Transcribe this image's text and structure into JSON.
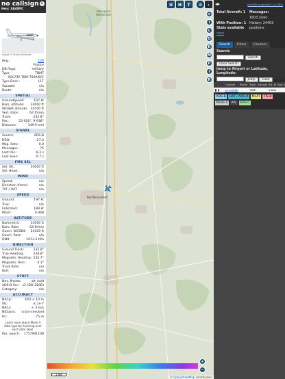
{
  "aircraft": {
    "callsign": "no callsign",
    "hex_label": "Hex: 3A48FC",
    "photo_credit": "Image © Bruno Muthelet",
    "info_rows": [
      {
        "k": "Reg.:",
        "v": "126",
        "link": true
      },
      {
        "k": "",
        "v": "France"
      },
      {
        "k": "DB flags:",
        "v": "military"
      },
      {
        "k": "Type:",
        "v": "TBM7"
      },
      {
        "k": "",
        "v": "SOCATA TBM-700A/B/C"
      },
      {
        "k": "Type Desc.:",
        "v": "L1T"
      },
      {
        "k": "Squawk:",
        "v": "n/a"
      },
      {
        "k": "Route:",
        "v": "n/a"
      }
    ],
    "sections": [
      {
        "title": "SPATIAL",
        "rows": [
          {
            "k": "Groundspeed:",
            "v": "197 kt"
          },
          {
            "k": "Baro. altitude:",
            "v": "24000 ft"
          },
          {
            "k": "WGS84 altitude:",
            "v": "24100 ft"
          },
          {
            "k": "Vert. Rate:",
            "v": "64 ft/min"
          },
          {
            "k": "Track:",
            "v": "232.8°"
          },
          {
            "k": "Pos.:",
            "v": "53.926°, 9.938°"
          },
          {
            "k": "Distance:",
            "v": "149.9 nmi"
          }
        ]
      },
      {
        "title": "SIGNAL",
        "rows": [
          {
            "k": "Source:",
            "v": "ADS-B"
          },
          {
            "k": "RSSI:",
            "v": "-27.5"
          },
          {
            "k": "Msg. Rate:",
            "v": "0.0"
          },
          {
            "k": "Messages:",
            "v": "75"
          },
          {
            "k": "Last Pos.:",
            "v": "8.2 s"
          },
          {
            "k": "Last Seen:",
            "v": "6.7 s"
          }
        ]
      },
      {
        "title": "FMS SEL",
        "rows": [
          {
            "k": "Sel. Alt.:",
            "v": "20000 ft"
          },
          {
            "k": "Sel. Head.:",
            "v": "n/a"
          }
        ]
      },
      {
        "title": "WIND",
        "rows": [
          {
            "k": "Speed:",
            "v": "n/a"
          },
          {
            "k": "Direction (from):",
            "v": "n/a"
          },
          {
            "k": "TAT / OAT:",
            "v": "n/a"
          }
        ]
      },
      {
        "title": "SPEED",
        "rows": [
          {
            "k": "Ground:",
            "v": "197 kt"
          },
          {
            "k": "True:",
            "v": "n/a"
          },
          {
            "k": "Indicated:",
            "v": "189 kt"
          },
          {
            "k": "Mach:",
            "v": "0.468"
          }
        ]
      },
      {
        "title": "ALTITUDE",
        "rows": [
          {
            "k": "Barometric:",
            "v": "24000 ft"
          },
          {
            "k": "Baro. Rate:",
            "v": "64 ft/min"
          },
          {
            "k": "Geom. WGS84:",
            "v": "24100 ft"
          },
          {
            "k": "Geom. Rate:",
            "v": "n/a"
          },
          {
            "k": "QNH:",
            "v": "1013.3 hPa"
          }
        ]
      },
      {
        "title": "DIRECTION",
        "rows": [
          {
            "k": "Ground Track:",
            "v": "232.8°"
          },
          {
            "k": "True Heading:",
            "v": "228.8°"
          },
          {
            "k": "Magnetic Heading:",
            "v": "232.7°"
          },
          {
            "k": "Magnetic Decl.:",
            "v": "4.3°"
          },
          {
            "k": "Track Rate:",
            "v": "n/a"
          },
          {
            "k": "Roll:",
            "v": "n/a"
          }
        ]
      },
      {
        "title": "STUFF",
        "rows": [
          {
            "k": "Nav. Modes:",
            "v": "alt_hold"
          },
          {
            "k": "ADS-B Ver.:",
            "v": "v2 (DO-260B)"
          },
          {
            "k": "Category:",
            "v": "n/a"
          }
        ]
      },
      {
        "title": "ACCURACY",
        "rows": [
          {
            "k": "NACp:",
            "v": "EPU < 10 m"
          },
          {
            "k": "SIL:",
            "v": "≤ 1e-7"
          },
          {
            "k": "NACv:",
            "v": "< 3 m/s"
          },
          {
            "k": "NICbaro:",
            "v": "cross-checked"
          },
          {
            "k": "Rc:",
            "v": "75 m"
          }
        ]
      }
    ],
    "note": "Learn more about Mode S data type by hovering over each data label.",
    "pos_epoch_label": "Pos. epoch:",
    "pos_epoch_value": "1757941108"
  },
  "map": {
    "place_label": "Bad Bramstedt",
    "town_label_top": "Naturpark Westensee",
    "top_buttons": [
      "U",
      "H",
      "T"
    ],
    "side_buttons": [
      "L",
      "O",
      "K",
      "M",
      "P",
      "I",
      "R"
    ],
    "attribution_prefix": "©",
    "attribution_link": "OpenStreetMap",
    "attribution_suffix": "contributors",
    "scale_label": "1 NM",
    "zoom_in": "+",
    "zoom_out": "−",
    "accent": "#1f4d7a"
  },
  "stats": {
    "version": "tar1090 on github (3.14.1762)",
    "total_label": "Total Aircraft: 1",
    "messages_label": "Messages:",
    "messages_value": "1603.2/sec",
    "with_pos_label": "With Position: 1",
    "history_label": "History: 24403",
    "history_value": "positions",
    "stats_label": "Stats available",
    "stats_link": "here"
  },
  "tabs": [
    "Search",
    "Filters",
    "Columns"
  ],
  "search": {
    "search_label": "Search:",
    "search_button": "Search",
    "clear_button": "Clear Search",
    "jump_label": "Jump to Airport or Latitude, Longitude:",
    "jump_button": "Jump",
    "clear2_button": "Clear"
  },
  "table": {
    "headers": [
      "",
      "Callsign",
      "Route",
      "Type",
      "Squawk",
      "Alt. (ft)",
      "Spd. (kt)"
    ],
    "row": [
      "",
      "no callsign",
      "",
      "TBM7",
      "",
      "24000",
      ""
    ]
  },
  "legend": [
    {
      "label": "ADS-B",
      "color": "#8fd3f2"
    },
    {
      "label": "UAT / ADS-R",
      "color": "#4fb3d0"
    },
    {
      "label": "MLAT",
      "color": "#e6e68a"
    },
    {
      "label": "TIS-B",
      "color": "#ff9aa8"
    },
    {
      "label": "Mode-S",
      "color": "#cfcfcf"
    },
    {
      "label": "AIS",
      "color": "#454545"
    },
    {
      "label": "ADS-C",
      "color": "#9fe29f"
    }
  ]
}
